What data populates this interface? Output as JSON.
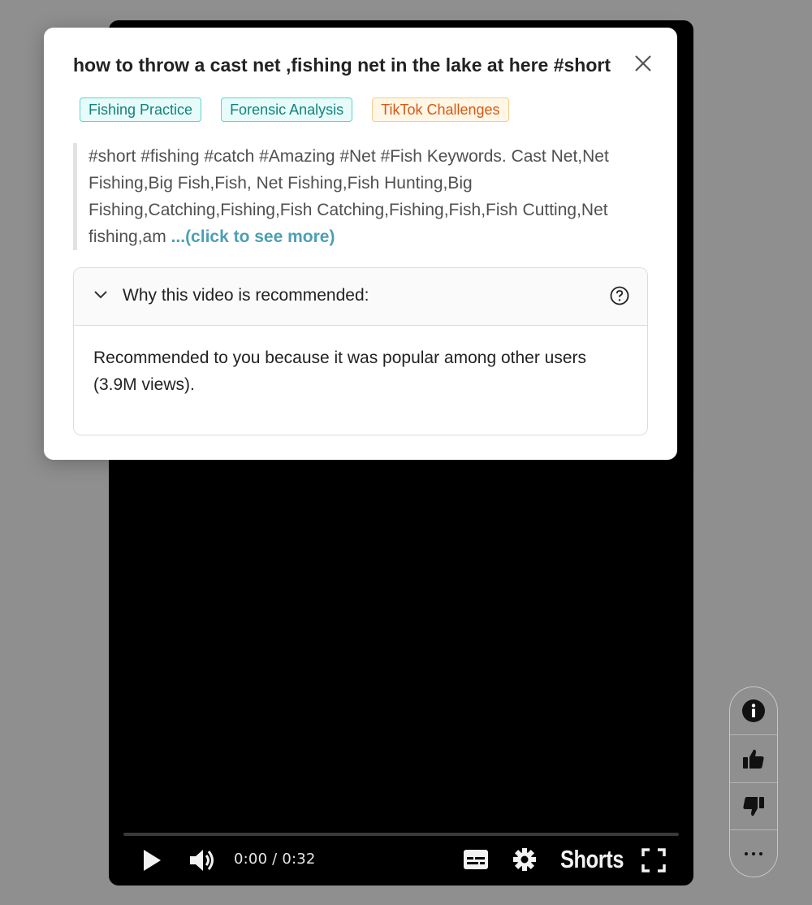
{
  "modal": {
    "title": "how to throw a cast net ,fishing net in the lake at here #short",
    "tags": [
      {
        "label": "Fishing Practice",
        "color": "#12837c"
      },
      {
        "label": "Forensic Analysis",
        "color": "#12837c"
      },
      {
        "label": "TikTok Challenges",
        "color": "#d65a12"
      }
    ],
    "description": "#short #fishing #catch #Amazing #Net #Fish Keywords. Cast Net,Net Fishing,Big Fish,Fish, Net Fishing,Fish Hunting,Big Fishing,Catching,Fishing,Fish Catching,Fishing,Fish,Fish Cutting,Net fishing,am",
    "see_more": "...(click to see more)",
    "why_label": "Why this video is recommended:",
    "why_body": "Recommended to you because it was popular among other users (3.9M views).",
    "icons": {
      "close": "close-icon",
      "chevron": "chevron-down-icon",
      "help": "question-circle-icon"
    }
  },
  "player": {
    "time": "0:00 / 0:32",
    "shorts_label": "Shorts",
    "progress": 0,
    "icons": [
      "play-icon",
      "volume-icon",
      "subtitles-icon",
      "settings-icon",
      "fullscreen-icon"
    ]
  },
  "side_rail": {
    "icons": [
      "info-icon",
      "thumbs-up-icon",
      "thumbs-down-icon",
      "more-icon"
    ]
  }
}
